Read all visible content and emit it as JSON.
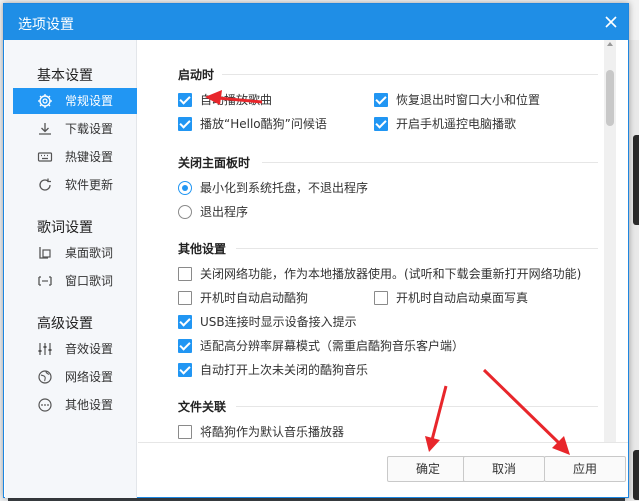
{
  "window": {
    "title": "选项设置"
  },
  "sidebar": {
    "groups": [
      {
        "title": "基本设置",
        "items": [
          {
            "label": "常规设置",
            "icon": "gear-icon",
            "active": true
          },
          {
            "label": "下载设置",
            "icon": "download-icon"
          },
          {
            "label": "热键设置",
            "icon": "keyboard-icon"
          },
          {
            "label": "软件更新",
            "icon": "refresh-icon"
          }
        ]
      },
      {
        "title": "歌词设置",
        "items": [
          {
            "label": "桌面歌词",
            "icon": "desktop-lyrics-icon"
          },
          {
            "label": "窗口歌词",
            "icon": "window-lyrics-icon"
          }
        ]
      },
      {
        "title": "高级设置",
        "items": [
          {
            "label": "音效设置",
            "icon": "equalizer-icon"
          },
          {
            "label": "网络设置",
            "icon": "globe-icon"
          },
          {
            "label": "其他设置",
            "icon": "more-icon"
          }
        ]
      }
    ]
  },
  "content": {
    "startup": {
      "title": "启动时",
      "options": [
        {
          "label": "自动播放歌曲",
          "checked": true
        },
        {
          "label": "恢复退出时窗口大小和位置",
          "checked": true
        },
        {
          "label": "播放“Hello酷狗”问候语",
          "checked": true
        },
        {
          "label": "开启手机遥控电脑播歌",
          "checked": true
        }
      ]
    },
    "close_panel": {
      "title": "关闭主面板时",
      "options": [
        {
          "label": "最小化到系统托盘，不退出程序",
          "selected": true
        },
        {
          "label": "退出程序",
          "selected": false
        }
      ]
    },
    "other": {
      "title": "其他设置",
      "options": [
        {
          "label": "关闭网络功能，作为本地播放器使用。(试听和下载会重新打开网络功能)",
          "checked": false
        },
        {
          "label": "开机时自动启动酷狗",
          "checked": false
        },
        {
          "label": "开机时自动启动桌面写真",
          "checked": false
        },
        {
          "label": "USB连接时显示设备接入提示",
          "checked": true
        },
        {
          "label": "适配高分辨率屏幕模式（需重启酷狗音乐客户端）",
          "checked": true
        },
        {
          "label": "自动打开上次未关闭的酷狗音乐",
          "checked": true
        }
      ]
    },
    "file_assoc": {
      "title": "文件关联",
      "options": [
        {
          "label": "将酷狗作为默认音乐播放器",
          "checked": false
        }
      ]
    }
  },
  "footer": {
    "ok_label": "确定",
    "cancel_label": "取消",
    "apply_label": "应用"
  },
  "colors": {
    "accent": "#1f8ee6",
    "active_item": "#2196f3",
    "annotation": "#e8262b"
  }
}
